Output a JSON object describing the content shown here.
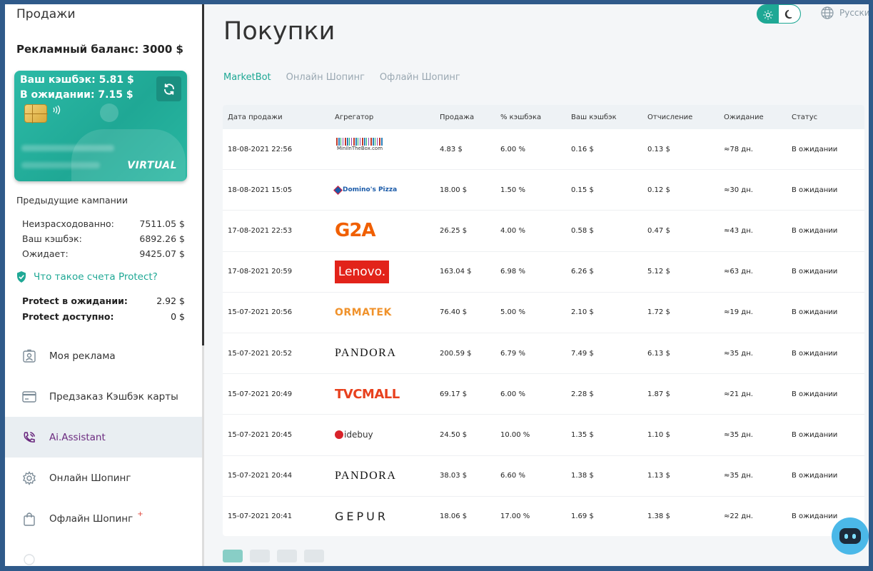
{
  "sidebar": {
    "title": "Продажи",
    "ad_balance": "Рекламный баланс: 3000 $",
    "card": {
      "cashback": "Ваш кэшбэк: 5.81 $",
      "pending": "В ожидании: 7.15 $",
      "label": "VIRTUAL"
    },
    "prev_title": "Предыдущие кампании",
    "stats": [
      {
        "label": "Неизрасходованно:",
        "value": "7511.05 $"
      },
      {
        "label": "Ваш кэшбэк:",
        "value": "6892.26 $"
      },
      {
        "label": "Ожидает:",
        "value": "9425.07 $"
      }
    ],
    "protect_link": "Что такое счета Protect?",
    "protect_stats": [
      {
        "label": "Protect в ожидании:",
        "value": "2.92 $"
      },
      {
        "label": "Protect доступно:",
        "value": "0 $"
      }
    ],
    "menu": [
      {
        "label": "Моя реклама",
        "icon": "user-card-icon"
      },
      {
        "label": "Предзаказ Кэшбэк карты",
        "icon": "credit-card-icon"
      },
      {
        "label": "Ai.Assistant",
        "icon": "phone-icon"
      },
      {
        "label": "Онлайн Шопинг",
        "icon": "gear-icon"
      },
      {
        "label": "Офлайн Шопинг",
        "icon": "shopping-bag-icon",
        "badge": "+"
      }
    ]
  },
  "header": {
    "language": "Русский"
  },
  "main": {
    "title": "Покупки",
    "tabs": [
      "MarketBot",
      "Онлайн Шопинг",
      "Офлайн Шопинг"
    ],
    "columns": [
      "Дата продажи",
      "Агрегатор",
      "Продажа",
      "% кэшбэка",
      "Ваш кэшбэк",
      "Отчисление",
      "Ожидание",
      "Статус"
    ],
    "rows": [
      {
        "date": "18-08-2021 22:56",
        "logo": "MiniInTheBox.com",
        "sale": "4.83 $",
        "pct": "6.00 %",
        "cashback": "0.16 $",
        "deduction": "0.13 $",
        "wait": "≈78 дн.",
        "status": "В ожидании"
      },
      {
        "date": "18-08-2021 15:05",
        "logo": "Domino's Pizza",
        "sale": "18.00 $",
        "pct": "1.50 %",
        "cashback": "0.15 $",
        "deduction": "0.12 $",
        "wait": "≈30 дн.",
        "status": "В ожидании"
      },
      {
        "date": "17-08-2021 22:53",
        "logo": "G2A",
        "sale": "26.25 $",
        "pct": "4.00 %",
        "cashback": "0.58 $",
        "deduction": "0.47 $",
        "wait": "≈43 дн.",
        "status": "В ожидании"
      },
      {
        "date": "17-08-2021 20:59",
        "logo": "Lenovo.",
        "sale": "163.04 $",
        "pct": "6.98 %",
        "cashback": "6.26 $",
        "deduction": "5.12 $",
        "wait": "≈63 дн.",
        "status": "В ожидании"
      },
      {
        "date": "15-07-2021 20:56",
        "logo": "ORMATEK",
        "sale": "76.40 $",
        "pct": "5.00 %",
        "cashback": "2.10 $",
        "deduction": "1.72 $",
        "wait": "≈19 дн.",
        "status": "В ожидании"
      },
      {
        "date": "15-07-2021 20:52",
        "logo": "PANDORA",
        "sale": "200.59 $",
        "pct": "6.79 %",
        "cashback": "7.49 $",
        "deduction": "6.13 $",
        "wait": "≈35 дн.",
        "status": "В ожидании"
      },
      {
        "date": "15-07-2021 20:49",
        "logo": "TVCMALL",
        "sale": "69.17 $",
        "pct": "6.00 %",
        "cashback": "2.28 $",
        "deduction": "1.87 $",
        "wait": "≈21 дн.",
        "status": "В ожидании"
      },
      {
        "date": "15-07-2021 20:45",
        "logo": "idebuy",
        "sale": "24.50 $",
        "pct": "10.00 %",
        "cashback": "1.35 $",
        "deduction": "1.10 $",
        "wait": "≈35 дн.",
        "status": "В ожидании"
      },
      {
        "date": "15-07-2021 20:44",
        "logo": "PANDORA",
        "sale": "38.03 $",
        "pct": "6.60 %",
        "cashback": "1.38 $",
        "deduction": "1.13 $",
        "wait": "≈35 дн.",
        "status": "В ожидании"
      },
      {
        "date": "15-07-2021 20:41",
        "logo": "GEPUR",
        "sale": "18.06 $",
        "pct": "17.00 %",
        "cashback": "1.69 $",
        "deduction": "1.38 $",
        "wait": "≈22 дн.",
        "status": "В ожидании"
      }
    ]
  },
  "colors": {
    "accent": "#1fa895",
    "active_menu_text": "#6b2a7f",
    "frame": "#2f5a8a"
  }
}
